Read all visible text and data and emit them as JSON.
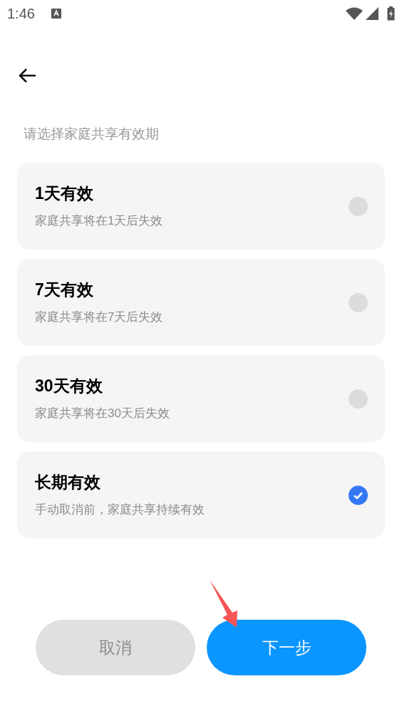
{
  "status_bar": {
    "time": "1:46"
  },
  "heading": "请选择家庭共享有效期",
  "options": [
    {
      "title": "1天有效",
      "description": "家庭共享将在1天后失效",
      "selected": false
    },
    {
      "title": "7天有效",
      "description": "家庭共享将在7天后失效",
      "selected": false
    },
    {
      "title": "30天有效",
      "description": "家庭共享将在30天后失效",
      "selected": false
    },
    {
      "title": "长期有效",
      "description": "手动取消前，家庭共享持续有效",
      "selected": true
    }
  ],
  "buttons": [
    {
      "label": "取消",
      "kind": "secondary"
    },
    {
      "label": "下一步",
      "kind": "primary"
    }
  ]
}
